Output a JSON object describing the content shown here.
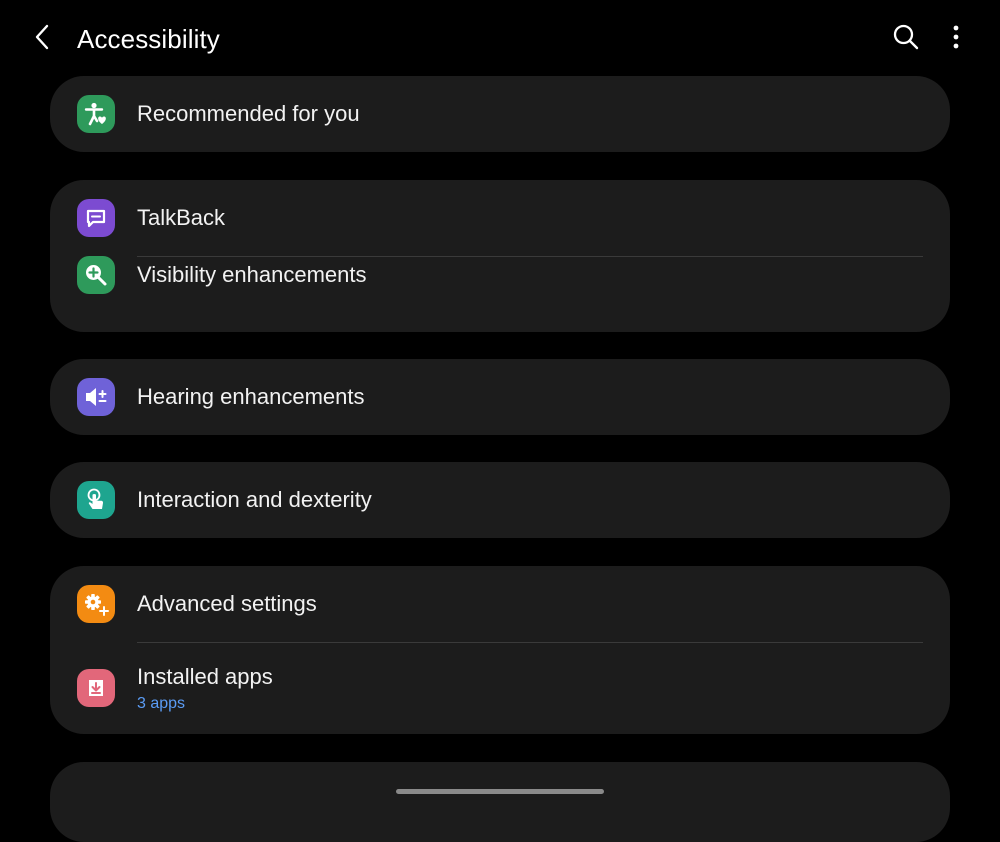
{
  "header": {
    "title": "Accessibility",
    "back_icon": "chevron-left-icon",
    "search_icon": "search-icon",
    "more_icon": "more-vertical-icon"
  },
  "groups": [
    {
      "items": [
        {
          "label": "Recommended for you",
          "icon": "accessibility-heart-icon",
          "icon_color": "#2e9a5b"
        }
      ]
    },
    {
      "items": [
        {
          "label": "TalkBack",
          "icon": "speech-bubble-icon",
          "icon_color": "#7c4bd1"
        },
        {
          "label": "Visibility enhancements",
          "icon": "magnifier-plus-icon",
          "icon_color": "#2e9a5b"
        }
      ]
    },
    {
      "items": [
        {
          "label": "Hearing enhancements",
          "icon": "speaker-plus-minus-icon",
          "icon_color": "#6f62d8"
        }
      ]
    },
    {
      "items": [
        {
          "label": "Interaction and dexterity",
          "icon": "touch-hand-icon",
          "icon_color": "#1ea58f"
        }
      ]
    },
    {
      "items": [
        {
          "label": "Advanced settings",
          "icon": "gear-plus-icon",
          "icon_color": "#f38b12"
        },
        {
          "label": "Installed apps",
          "sublabel": "3 apps",
          "icon": "download-icon",
          "icon_color": "#e2677a"
        }
      ]
    }
  ],
  "colors": {
    "background": "#000000",
    "card": "#1c1c1c",
    "divider": "#3a3a3a",
    "accent_text": "#5b9cf5"
  }
}
